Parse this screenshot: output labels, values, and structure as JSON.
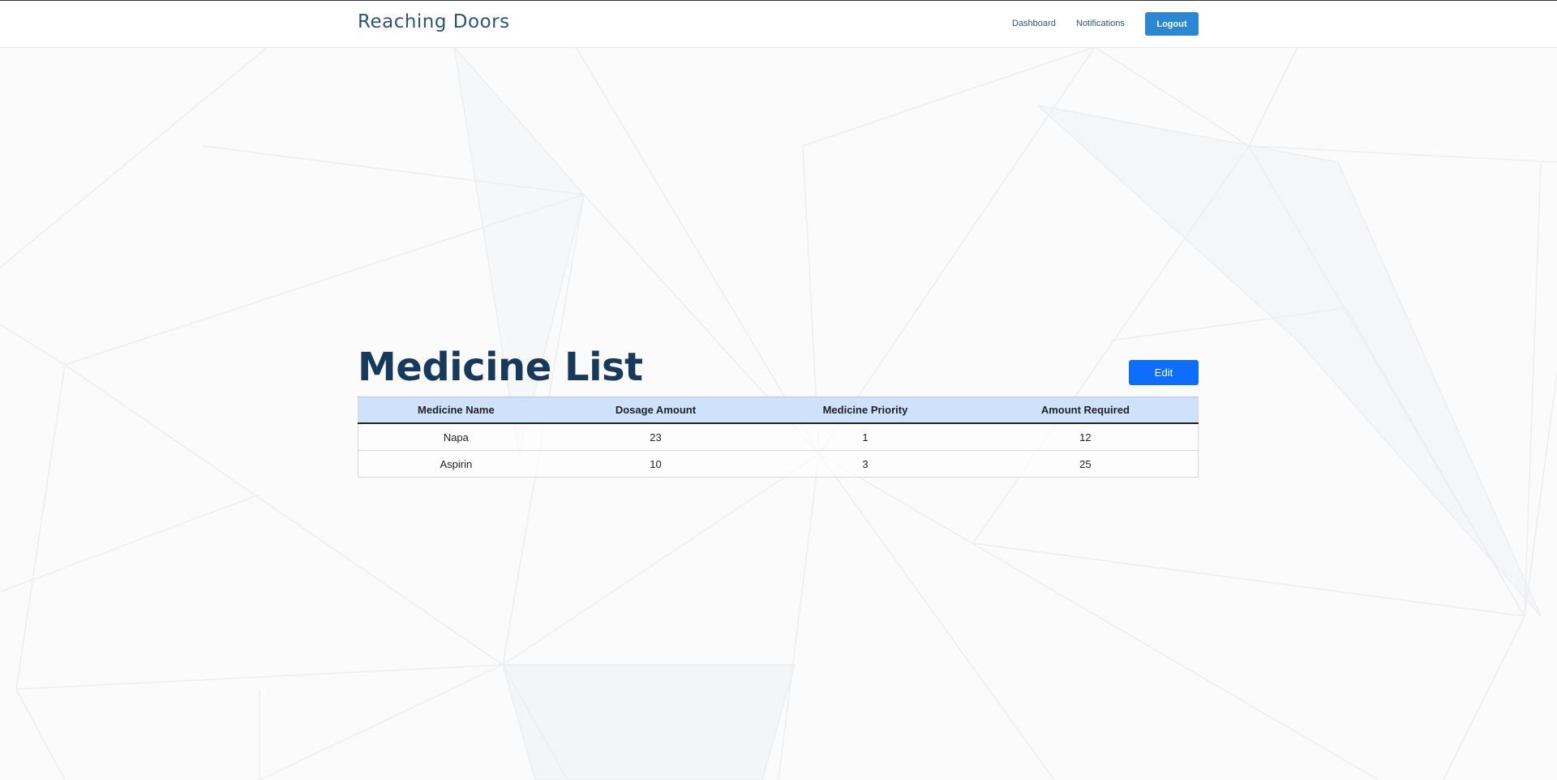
{
  "navbar": {
    "brand": "Reaching Doors",
    "links": {
      "dashboard": "Dashboard",
      "notifications": "Notifications"
    },
    "logout_label": "Logout"
  },
  "main": {
    "title": "Medicine List",
    "edit_label": "Edit",
    "table": {
      "headers": [
        "Medicine Name",
        "Dosage Amount",
        "Medicine Priority",
        "Amount Required"
      ],
      "rows": [
        [
          "Napa",
          "23",
          "1",
          "12"
        ],
        [
          "Aspirin",
          "10",
          "3",
          "25"
        ]
      ]
    }
  },
  "colors": {
    "brand_text": "#2d5475",
    "title_text": "#173a5c",
    "logout_button": "#2b87d1",
    "edit_button": "#0d6efd",
    "table_header_bg": "#cfe2fc"
  }
}
